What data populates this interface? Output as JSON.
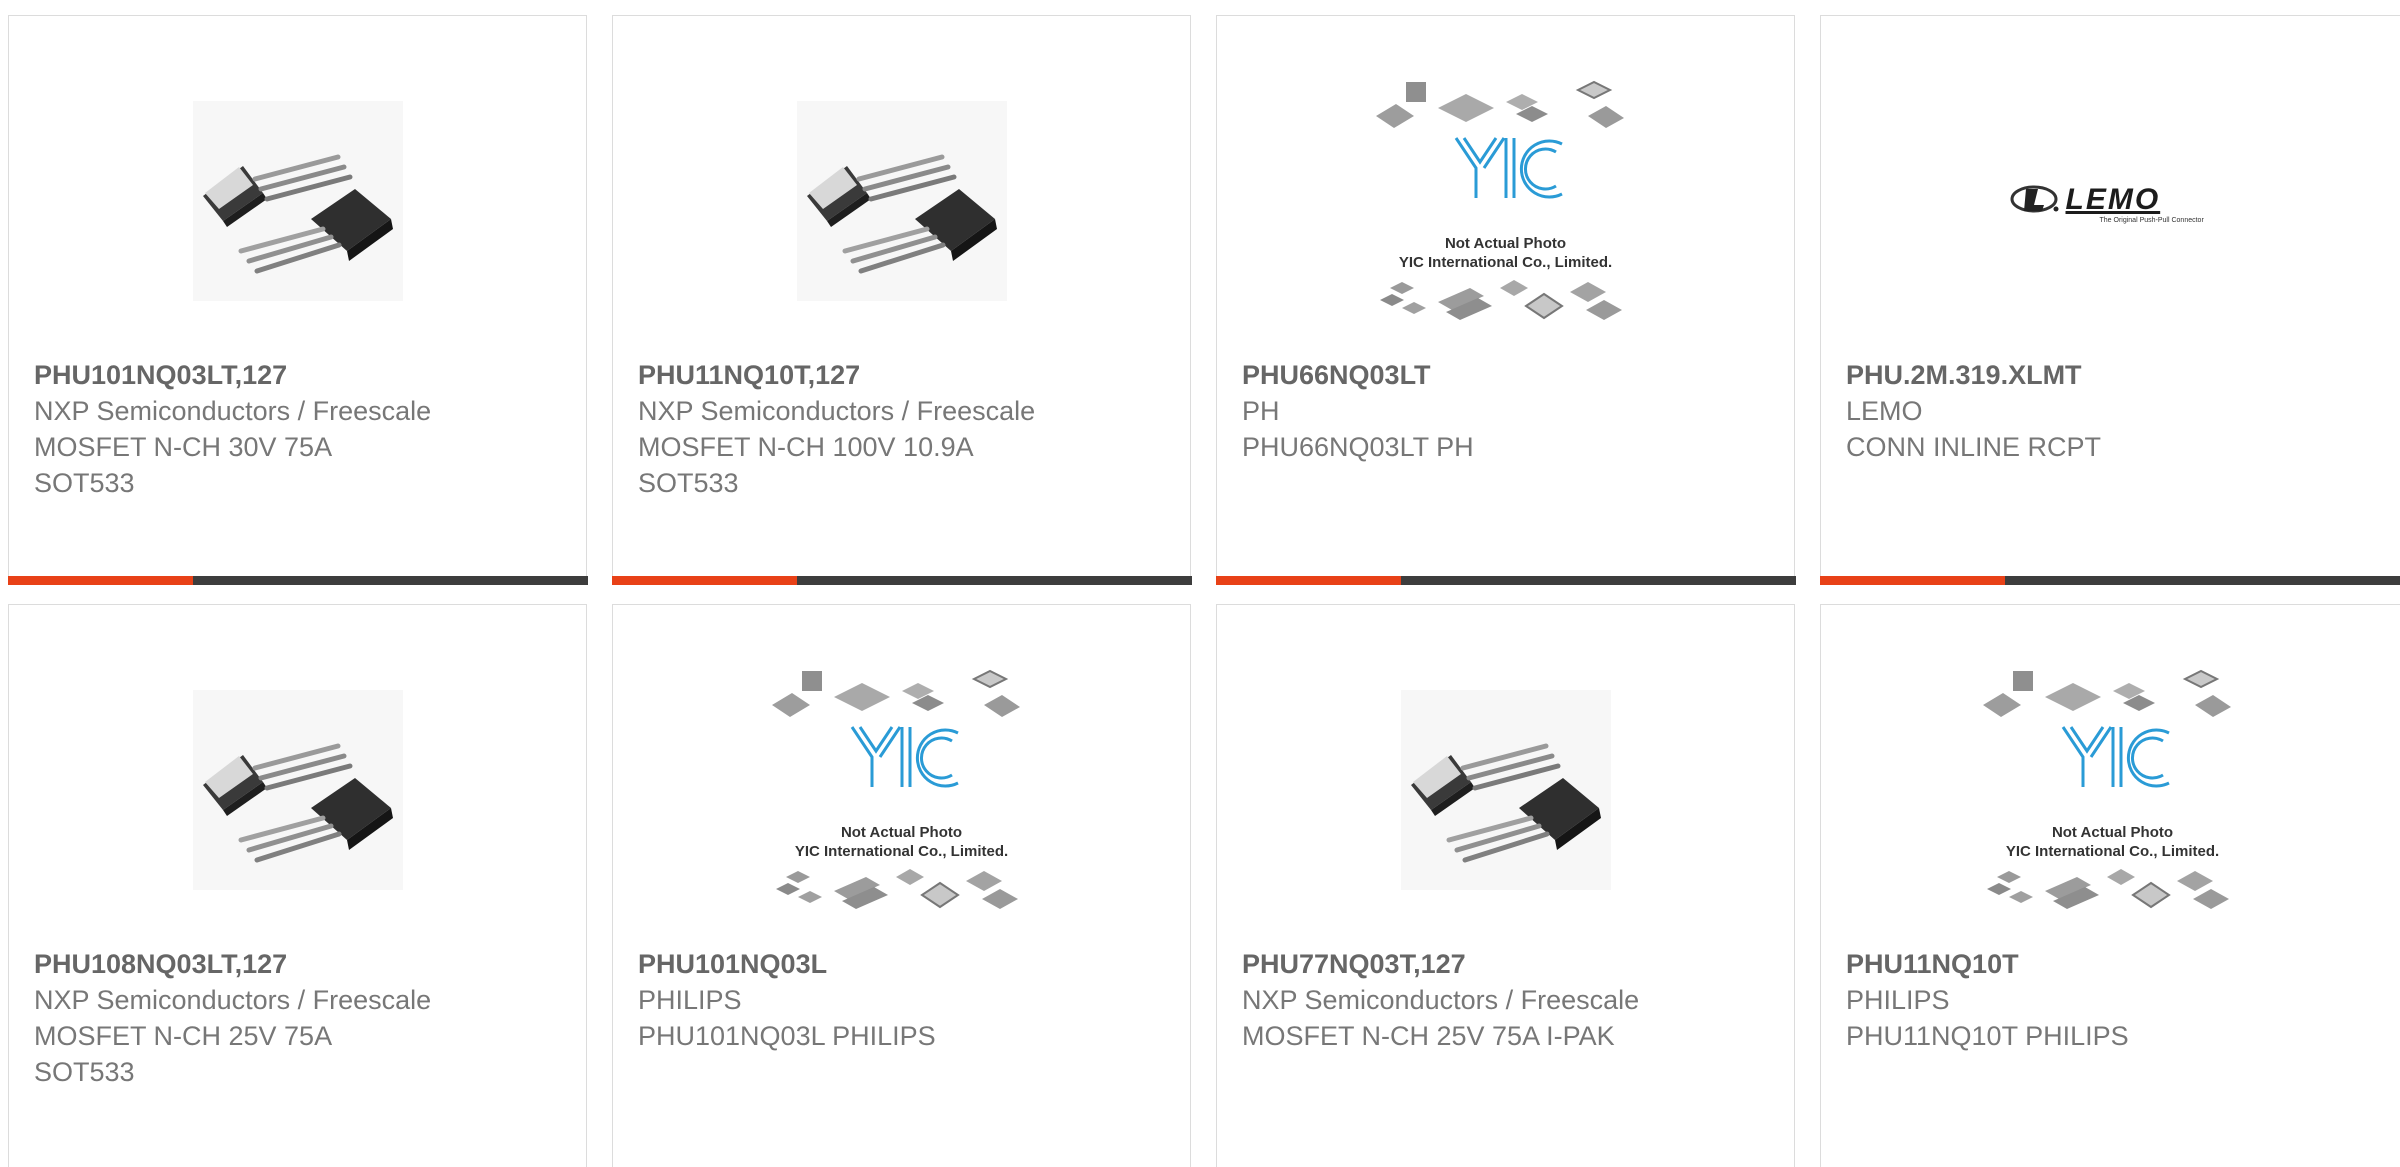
{
  "colors": {
    "accent": "#e84117",
    "bar_dark": "#3d3d3d",
    "card_border": "#dcdcdc",
    "text": "#666666",
    "logo_blue": "#2a9bd6"
  },
  "placeholder": {
    "brand": "YIC",
    "line1": "Not Actual Photo",
    "line2": "YIC International Co., Limited."
  },
  "lemo": {
    "wordmark": "LEMO",
    "tagline": "The Original Push-Pull Connector"
  },
  "products": [
    {
      "part_number": "PHU101NQ03LT,127",
      "manufacturer": "NXP Semiconductors / Freescale",
      "description": "MOSFET N-CH 30V 75A",
      "package": "SOT533",
      "image": "transistor-photo"
    },
    {
      "part_number": "PHU11NQ10T,127",
      "manufacturer": "NXP Semiconductors / Freescale",
      "description": "MOSFET N-CH 100V 10.9A",
      "package": "SOT533",
      "image": "transistor-photo"
    },
    {
      "part_number": "PHU66NQ03LT",
      "manufacturer": "PH",
      "description": "PHU66NQ03LT PH",
      "package": "",
      "image": "yic-placeholder"
    },
    {
      "part_number": "PHU.2M.319.XLMT",
      "manufacturer": "LEMO",
      "description": "CONN INLINE RCPT",
      "package": "",
      "image": "lemo-logo"
    },
    {
      "part_number": "PHU108NQ03LT,127",
      "manufacturer": "NXP Semiconductors / Freescale",
      "description": "MOSFET N-CH 25V 75A",
      "package": "SOT533",
      "image": "transistor-photo"
    },
    {
      "part_number": "PHU101NQ03L",
      "manufacturer": "PHILIPS",
      "description": "PHU101NQ03L PHILIPS",
      "package": "",
      "image": "yic-placeholder"
    },
    {
      "part_number": "PHU77NQ03T,127",
      "manufacturer": "NXP Semiconductors / Freescale",
      "description": "MOSFET N-CH 25V 75A I-PAK",
      "package": "",
      "image": "transistor-photo"
    },
    {
      "part_number": "PHU11NQ10T",
      "manufacturer": "PHILIPS",
      "description": "PHU11NQ10T PHILIPS",
      "package": "",
      "image": "yic-placeholder"
    }
  ]
}
